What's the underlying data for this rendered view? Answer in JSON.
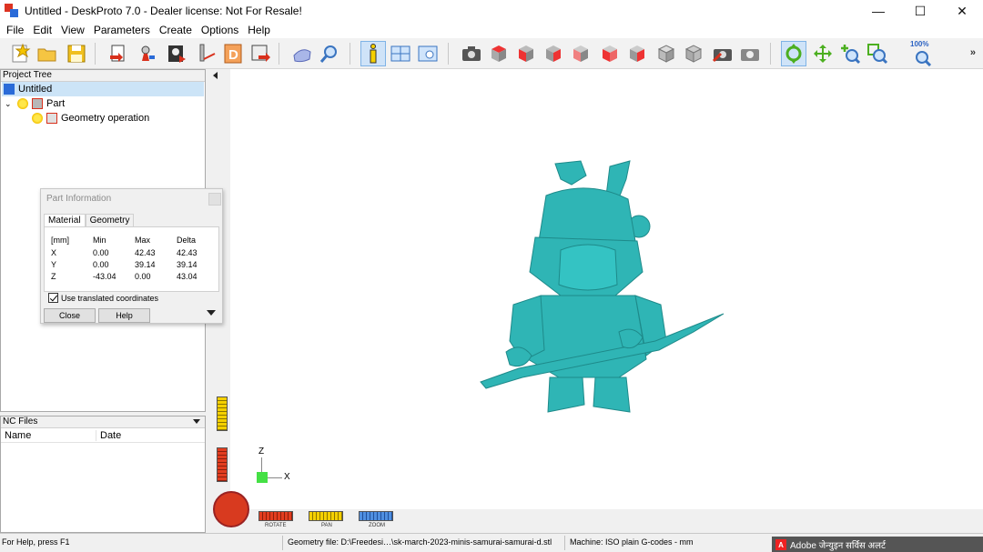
{
  "window": {
    "title": "Untitled - DeskProto 7.0 - Dealer license: Not For Resale!",
    "minimize": "—",
    "maximize": "☐",
    "close": "✕"
  },
  "menu": [
    "File",
    "Edit",
    "View",
    "Parameters",
    "Create",
    "Options",
    "Help"
  ],
  "toolbar": {
    "zoom_label": "100%",
    "more": "»"
  },
  "project_tree": {
    "title": "Project Tree",
    "items": [
      {
        "label": "Untitled"
      },
      {
        "label": "Part"
      },
      {
        "label": "Geometry operation"
      }
    ]
  },
  "nc_files": {
    "title": "NC Files",
    "columns": [
      "Name",
      "Date"
    ]
  },
  "part_info": {
    "title": "Part Information",
    "tabs": [
      "Material",
      "Geometry"
    ],
    "header": [
      "[mm]",
      "Min",
      "Max",
      "Delta"
    ],
    "rows": [
      [
        "X",
        "0.00",
        "42.43",
        "42.43"
      ],
      [
        "Y",
        "0.00",
        "39.14",
        "39.14"
      ],
      [
        "Z",
        "-43.04",
        "0.00",
        "43.04"
      ]
    ],
    "checkbox_label": "Use translated coordinates",
    "close_button": "Close",
    "help_button": "Help"
  },
  "viewport": {
    "axis_z": "Z",
    "axis_x": "X",
    "labels": [
      "ROTATE",
      "PAN",
      "ZOOM"
    ],
    "model_color": "#2fb5b5"
  },
  "status": {
    "help": "For Help, press F1",
    "geometry_file": "Geometry file: D:\\Freedesi…\\sk-march-2023-minis-samurai-samurai-d.stl",
    "machine": "Machine: ISO plain G-codes - mm",
    "adobe_alert": "Adobe जेन्युइन सर्विस अलर्ट"
  }
}
